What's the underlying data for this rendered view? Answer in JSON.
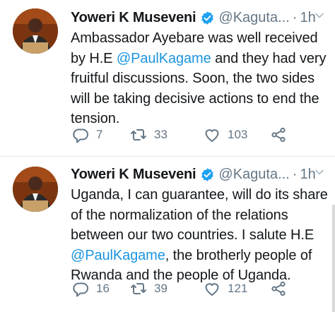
{
  "tweets": [
    {
      "author_name": "Yoweri K Museveni",
      "handle": "@Kaguta...",
      "separator": "·",
      "time": "1h",
      "text_before": "Ambassador Ayebare was well received by H.E ",
      "mention": "@PaulKagame",
      "text_after": " and they had very fruitful discussions. Soon, the two sides will be taking decisive actions to end the tension.",
      "replies": "7",
      "retweets": "33",
      "likes": "103"
    },
    {
      "author_name": "Yoweri K Museveni",
      "handle": "@Kaguta...",
      "separator": "·",
      "time": "1h",
      "text_before": "Uganda, I can guarantee, will do its share of the normalization of the relations between our two countries. I salute H.E ",
      "mention": "@PaulKagame",
      "text_after": ", the brotherly people of Rwanda and the people of Uganda.",
      "replies": "16",
      "retweets": "39",
      "likes": "121"
    }
  ],
  "colors": {
    "accent": "#1b95e0",
    "secondary_text": "#657786",
    "primary_text": "#14171a",
    "verified": "#1da1f2"
  },
  "icons": [
    "verified-badge-icon",
    "chevron-down-icon",
    "reply-icon",
    "retweet-icon",
    "like-icon",
    "share-icon"
  ]
}
